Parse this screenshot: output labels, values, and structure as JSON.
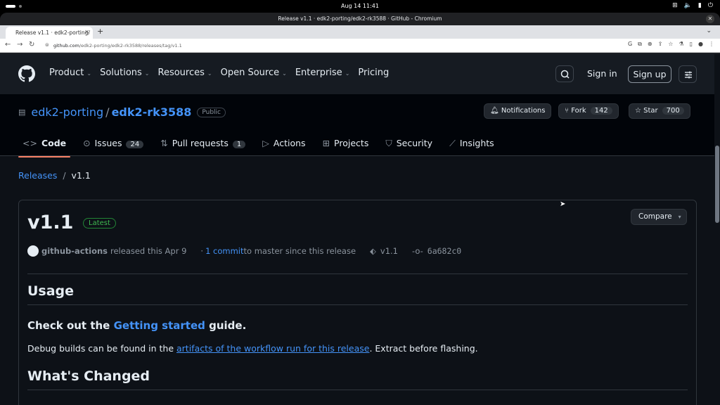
{
  "os": {
    "clock": "Aug 14  11:41",
    "tray": [
      "net-icon",
      "speaker-icon",
      "battery-icon",
      "power-icon"
    ]
  },
  "browser": {
    "window_title": "Release v1.1 · edk2-porting/edk2-rk3588 · GitHub - Chromium",
    "tab_title": "Release v1.1 · edk2-porting/",
    "url_host": "github.com",
    "url_path": "/edk2-porting/edk2-rk3588/releases/tag/v1.1"
  },
  "header": {
    "nav": [
      "Product",
      "Solutions",
      "Resources",
      "Open Source",
      "Enterprise",
      "Pricing"
    ],
    "sign_in": "Sign in",
    "sign_up": "Sign up"
  },
  "repo": {
    "owner": "edk2-porting",
    "slash": "/",
    "name": "edk2-rk3588",
    "visibility": "Public",
    "notifications": "Notifications",
    "fork": "Fork",
    "fork_count": "142",
    "star": "Star",
    "star_count": "700",
    "tabs": {
      "code": "Code",
      "issues": "Issues",
      "issues_count": "24",
      "pulls": "Pull requests",
      "pulls_count": "1",
      "actions": "Actions",
      "projects": "Projects",
      "security": "Security",
      "insights": "Insights"
    }
  },
  "breadcrumb": {
    "releases": "Releases",
    "sep": "/",
    "current": "v1.1"
  },
  "release": {
    "title": "v1.1",
    "latest": "Latest",
    "compare": "Compare",
    "actor": "github-actions",
    "released": "released this Apr 9",
    "commits_link": "1 commit",
    "commits_rest": " to master since this release",
    "tag": "v1.1",
    "sha": "6a682c0",
    "usage_heading": "Usage",
    "check_pre": "Check out the ",
    "check_link": "Getting started",
    "check_post": " guide.",
    "debug_pre": "Debug builds can be found in the ",
    "debug_link": "artifacts of the workflow run for this release",
    "debug_post": ". Extract before flashing.",
    "changed_heading": "What's Changed"
  },
  "colors": {
    "link": "#4493f8",
    "accent_tab": "#f78166",
    "latest_green": "#3fb950"
  }
}
